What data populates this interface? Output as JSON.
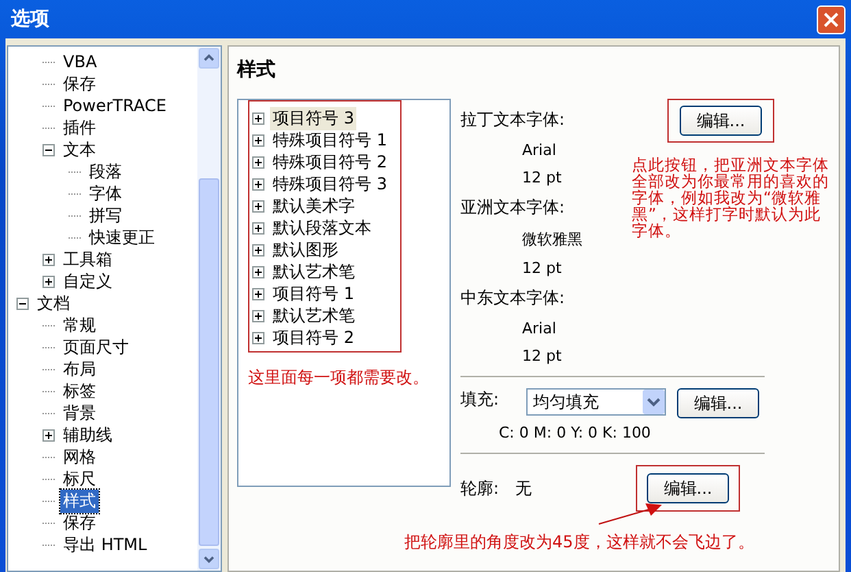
{
  "window": {
    "title": "选项"
  },
  "tree": [
    {
      "children": [
        {
          "label": "VBA",
          "selected": false
        },
        {
          "label": "保存",
          "selected": false
        },
        {
          "label": "PowerTRACE",
          "selected": false
        },
        {
          "label": "插件",
          "selected": false
        },
        {
          "label": "文本",
          "selected": false,
          "expanded": true,
          "children": [
            {
              "label": "段落",
              "selected": false
            },
            {
              "label": "字体",
              "selected": false
            },
            {
              "label": "拼写",
              "selected": false
            },
            {
              "label": "快速更正",
              "selected": false
            }
          ]
        },
        {
          "label": "工具箱",
          "selected": false,
          "expanded": false
        },
        {
          "label": "自定义",
          "selected": false,
          "expanded": false
        }
      ]
    },
    {
      "label": "文档",
      "selected": false,
      "expanded": true,
      "children": [
        {
          "label": "常规",
          "selected": false
        },
        {
          "label": "页面尺寸",
          "selected": false
        },
        {
          "label": "布局",
          "selected": false
        },
        {
          "label": "标签",
          "selected": false
        },
        {
          "label": "背景",
          "selected": false
        },
        {
          "label": "辅助线",
          "selected": false,
          "expanded": false
        },
        {
          "label": "网格",
          "selected": false
        },
        {
          "label": "标尺",
          "selected": false
        },
        {
          "label": "样式",
          "selected": true
        },
        {
          "label": "保存",
          "selected": false
        },
        {
          "label": "导出 HTML",
          "selected": false
        }
      ]
    }
  ],
  "panel": {
    "title": "样式",
    "styles": [
      {
        "label": "项目符号 3",
        "selected": true,
        "expanded": false
      },
      {
        "label": "特殊项目符号 1",
        "selected": false,
        "expanded": false
      },
      {
        "label": "特殊项目符号 2",
        "selected": false,
        "expanded": false
      },
      {
        "label": "特殊项目符号 3",
        "selected": false,
        "expanded": false
      },
      {
        "label": "默认美术字",
        "selected": false,
        "expanded": false
      },
      {
        "label": "默认段落文本",
        "selected": false,
        "expanded": false
      },
      {
        "label": "默认图形",
        "selected": false,
        "expanded": false
      },
      {
        "label": "默认艺术笔",
        "selected": false,
        "expanded": false
      },
      {
        "label": "项目符号 1",
        "selected": false,
        "expanded": false
      },
      {
        "label": "默认艺术笔",
        "selected": false,
        "expanded": false
      },
      {
        "label": "项目符号 2",
        "selected": false,
        "expanded": false
      }
    ],
    "styles_note": "这里面每一项都需要改。",
    "fonts": [
      {
        "label": "拉丁文本字体:",
        "name": "Arial",
        "size": "12 pt"
      },
      {
        "label": "亚洲文本字体:",
        "name": "微软雅黑",
        "size": "12 pt"
      },
      {
        "label": "中东文本字体:",
        "name": "Arial",
        "size": "12 pt"
      }
    ],
    "font_button": "编辑...",
    "font_note": "点此按钮，把亚洲文本字体全部改为你最常用的喜欢的字体，例如我改为“微软雅黑”，这样打字时默认为此字体。",
    "fill": {
      "label": "填充:",
      "value": "均匀填充",
      "button": "编辑...",
      "color_values": "C: 0 M: 0 Y: 0 K: 100"
    },
    "outline": {
      "label": "轮廓:",
      "value": "无",
      "button": "编辑..."
    },
    "outline_note": "把轮廓里的角度改为45度，这样就不会飞边了。"
  }
}
